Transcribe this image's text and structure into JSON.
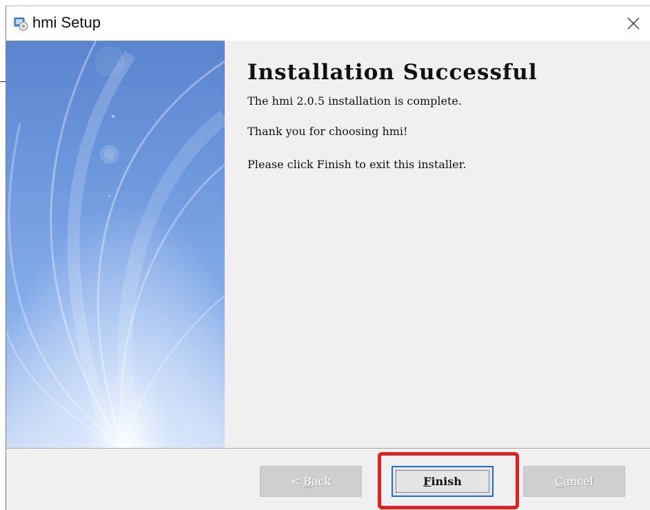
{
  "window": {
    "title": "hmi Setup",
    "app_icon": "installer-icon",
    "close_icon": "close-icon"
  },
  "content": {
    "heading": "Installation Successful",
    "line1": "The hmi 2.0.5 installation is complete.",
    "line2": "Thank you for choosing hmi!",
    "line3": "Please click Finish to exit this installer."
  },
  "buttons": {
    "back": {
      "mnemonic": "B",
      "rest": "ack",
      "prefix": "< ",
      "enabled": false
    },
    "finish": {
      "mnemonic": "F",
      "rest": "inish",
      "enabled": true,
      "focused": true
    },
    "cancel": {
      "mnemonic": "C",
      "rest": "ancel",
      "enabled": false
    }
  },
  "colors": {
    "highlight": "#e51f1f",
    "focus_border": "#1f6fd1",
    "side_panel": "#6c96dc"
  }
}
